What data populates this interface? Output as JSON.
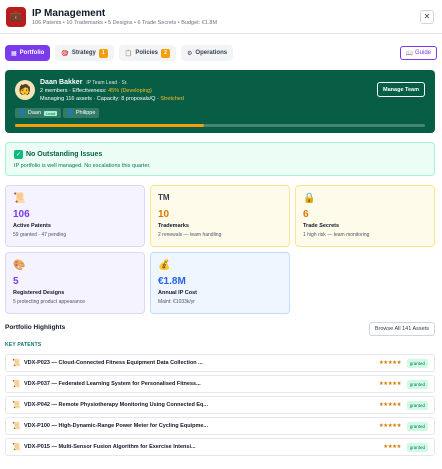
{
  "header": {
    "title": "IP Management",
    "subtitle": "106 Patents • 10 Trademarks • 5 Designs • 6 Trade Secrets • Budget: €1.8M",
    "close_label": "✕"
  },
  "tabs": [
    {
      "label": "Portfolio",
      "active": true
    },
    {
      "label": "Strategy",
      "badge": "1"
    },
    {
      "label": "Policies",
      "badge": "2"
    },
    {
      "label": "Operations"
    }
  ],
  "guide_label": "Guide",
  "lead": {
    "name": "Daan Bakker",
    "role": "IP Team Lead · Sr.",
    "line2_prefix": "2 members · Effectiveness:",
    "effectiveness": "45% (Developing)",
    "line3_prefix": "Managing 116 assets · Capacity: 8 proposals/Q ·",
    "capacity_state": "Stretched",
    "members": [
      {
        "name": "Daan",
        "tag": "Lead"
      },
      {
        "name": "Philippe"
      }
    ],
    "manage_label": "Manage Team",
    "progress_fraction": 0.46
  },
  "issues": {
    "title": "No Outstanding Issues",
    "subtitle": "IP portfolio is well managed. No escalations this quarter."
  },
  "stats": [
    {
      "value": "106",
      "label": "Active Patents",
      "sub": "59 granted · 47 pending"
    },
    {
      "value": "10",
      "label": "Trademarks",
      "sub": "2 renewals — team handling",
      "icon_text": "TM"
    },
    {
      "value": "6",
      "label": "Trade Secrets",
      "sub": "1 high risk — team monitoring"
    },
    {
      "value": "5",
      "label": "Registered Designs",
      "sub": "5 protecting product appearance"
    },
    {
      "value": "€1.8M",
      "label": "Annual IP Cost",
      "sub": "Maint: €1033k/yr"
    }
  ],
  "highlights": {
    "title": "Portfolio Highlights",
    "browse_label": "Browse All 141 Assets",
    "section_label": "KEY PATENTS",
    "rows": [
      {
        "title": "VDX-P023 — Cloud-Connected Fitness Equipment Data Collection ...",
        "stars": "★★★★★",
        "status": "granted"
      },
      {
        "title": "VDX-P037 — Federated Learning System for Personalised Fitness...",
        "stars": "★★★★★",
        "status": "granted"
      },
      {
        "title": "VDX-P042 — Remote Physiotherapy Monitoring Using Connected Eq...",
        "stars": "★★★★★",
        "status": "granted"
      },
      {
        "title": "VDX-P100 — High-Dynamic-Range Power Meter for Cycling Equipme...",
        "stars": "★★★★★",
        "status": "granted"
      },
      {
        "title": "VDX-P015 — Multi-Sensor Fusion Algorithm for Exercise Intensi...",
        "stars": "★★★★",
        "status": "granted"
      }
    ]
  },
  "colors": {
    "accent": "#7c3aed",
    "lead_bg": "#075e45",
    "warning": "#f59e0b",
    "success": "#10b981"
  }
}
